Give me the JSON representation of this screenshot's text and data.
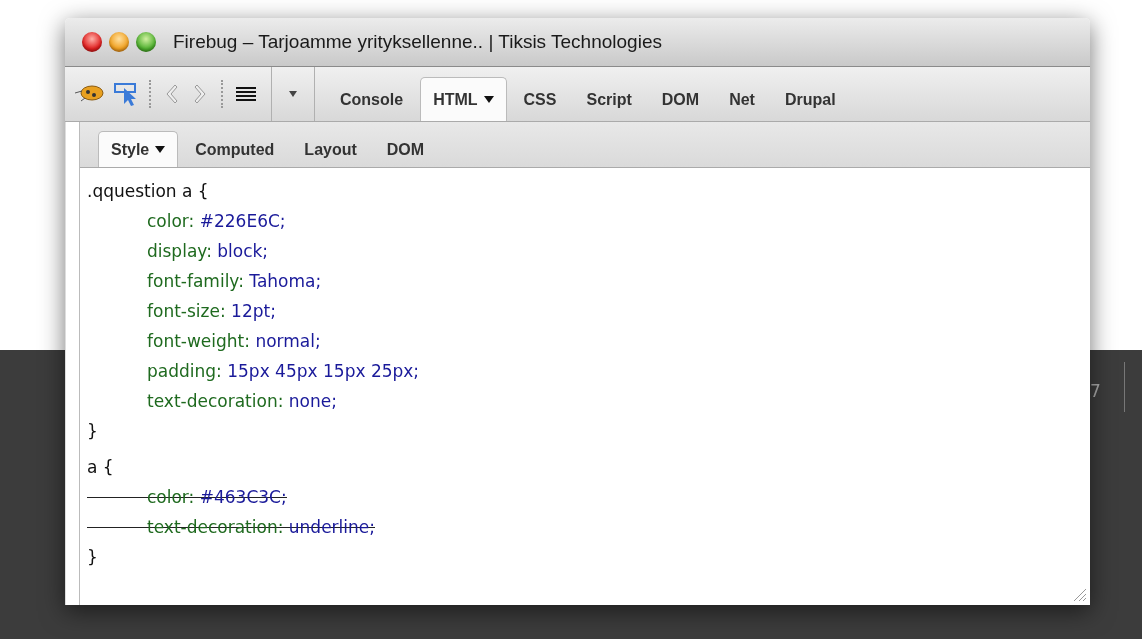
{
  "window": {
    "title": "Firebug – Tarjoamme yrityksellenne.. | Tiksis Technologies"
  },
  "panel_tabs": [
    {
      "label": "Console",
      "selected": false,
      "dropdown": false
    },
    {
      "label": "HTML",
      "selected": true,
      "dropdown": true
    },
    {
      "label": "CSS",
      "selected": false,
      "dropdown": false
    },
    {
      "label": "Script",
      "selected": false,
      "dropdown": false
    },
    {
      "label": "DOM",
      "selected": false,
      "dropdown": false
    },
    {
      "label": "Net",
      "selected": false,
      "dropdown": false
    },
    {
      "label": "Drupal",
      "selected": false,
      "dropdown": false
    }
  ],
  "side_tabs": [
    {
      "label": "Style",
      "selected": true,
      "dropdown": true
    },
    {
      "label": "Computed",
      "selected": false,
      "dropdown": false
    },
    {
      "label": "Layout",
      "selected": false,
      "dropdown": false
    },
    {
      "label": "DOM",
      "selected": false,
      "dropdown": false
    }
  ],
  "rules": [
    {
      "selector": ".qquestion a {",
      "close": "}",
      "declarations": [
        {
          "property": "color:",
          "value": "#226E6C;",
          "overridden": false
        },
        {
          "property": "display:",
          "value": "block;",
          "overridden": false
        },
        {
          "property": "font-family:",
          "value": "Tahoma;",
          "overridden": false
        },
        {
          "property": "font-size:",
          "value": "12pt;",
          "overridden": false
        },
        {
          "property": "font-weight:",
          "value": "normal;",
          "overridden": false
        },
        {
          "property": "padding:",
          "value": "15px 45px 15px 25px;",
          "overridden": false
        },
        {
          "property": "text-decoration:",
          "value": "none;",
          "overridden": false
        }
      ]
    },
    {
      "selector": "a {",
      "close": "}",
      "declarations": [
        {
          "property": "color:",
          "value": "#463C3C;",
          "overridden": true
        },
        {
          "property": "text-decoration:",
          "value": "underline;",
          "overridden": true
        }
      ]
    }
  ],
  "background_text": "7"
}
